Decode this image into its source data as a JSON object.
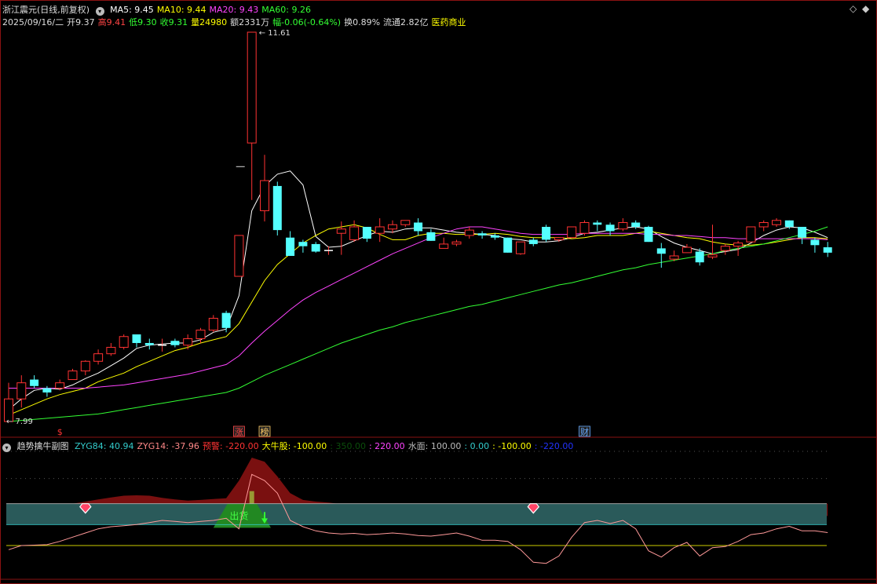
{
  "header": {
    "stock_title": "浙江震元(日线,前复权)",
    "ma_items": [
      {
        "label": "MA5: 9.45",
        "color": "#ffffff"
      },
      {
        "label": "MA10: 9.44",
        "color": "#ffff00"
      },
      {
        "label": "MA20: 9.43",
        "color": "#ff44ff"
      },
      {
        "label": "MA60: 9.26",
        "color": "#33ff33"
      }
    ],
    "quote_items": [
      {
        "label": "2025/09/16/二",
        "color": "#dddddd"
      },
      {
        "label": "开9.37",
        "color": "#dddddd"
      },
      {
        "label": "高9.41",
        "color": "#ff4444"
      },
      {
        "label": "低9.30",
        "color": "#33ff33"
      },
      {
        "label": "收9.31",
        "color": "#33ff33"
      },
      {
        "label": "量24980",
        "color": "#ffff00"
      },
      {
        "label": "额2331万",
        "color": "#dddddd"
      },
      {
        "label": "幅-0.06(-0.64%)",
        "color": "#33ff33"
      },
      {
        "label": "换0.89%",
        "color": "#dddddd"
      },
      {
        "label": "流通2.82亿",
        "color": "#dddddd"
      },
      {
        "label": "医药商业",
        "color": "#ffff00"
      }
    ]
  },
  "sub_header": {
    "title": "趋势擒牛副图",
    "items": [
      {
        "label": "ZYG84: 40.94",
        "color": "#33cccc"
      },
      {
        "label": "ZYG14: -37.96",
        "color": "#ff8888"
      },
      {
        "label": "预警: -220.00",
        "color": "#ff3333"
      },
      {
        "label": "大牛股: -100.00",
        "color": "#ffff00"
      },
      {
        "label": ": 350.00",
        "color": "#0b4d0b"
      },
      {
        "label": ": 220.00",
        "color": "#ff44ff"
      },
      {
        "label": "水面: 100.00",
        "color": "#bbbbbb"
      },
      {
        "label": ": 0.00",
        "color": "#33cccc"
      },
      {
        "label": ": -100.00",
        "color": "#ffff00"
      },
      {
        "label": ": -220.00",
        "color": "#2233ff"
      }
    ]
  },
  "controls": {
    "expand_icon": "◇",
    "collapse_icon": "◆",
    "menu_icon": "▾"
  },
  "chart_data": {
    "type": "candlestick",
    "y_range": [
      7.99,
      11.61
    ],
    "price_high_label": "11.61",
    "price_low_label": "7.99",
    "event_markers": [
      {
        "label": "$",
        "bar": 4,
        "color": "#ff3333"
      },
      {
        "label": "涨",
        "bar": 18,
        "color": "#ff4444"
      },
      {
        "label": "榜",
        "bar": 20,
        "color": "#ffcc66"
      },
      {
        "label": "财",
        "bar": 45,
        "color": "#66aaff"
      }
    ],
    "candles": [
      [
        7.99,
        8.2,
        8.35,
        7.99
      ],
      [
        8.2,
        8.35,
        8.42,
        8.12
      ],
      [
        8.38,
        8.32,
        8.42,
        8.3
      ],
      [
        8.3,
        8.26,
        8.32,
        8.22
      ],
      [
        8.3,
        8.35,
        8.38,
        8.28
      ],
      [
        8.38,
        8.46,
        8.48,
        8.38
      ],
      [
        8.46,
        8.55,
        8.56,
        8.42
      ],
      [
        8.55,
        8.62,
        8.66,
        8.52
      ],
      [
        8.62,
        8.68,
        8.72,
        8.6
      ],
      [
        8.68,
        8.78,
        8.8,
        8.66
      ],
      [
        8.8,
        8.72,
        8.8,
        8.68
      ],
      [
        8.72,
        8.7,
        8.76,
        8.66
      ],
      [
        8.7,
        8.7,
        8.76,
        8.64
      ],
      [
        8.74,
        8.7,
        8.76,
        8.68
      ],
      [
        8.7,
        8.76,
        8.8,
        8.66
      ],
      [
        8.76,
        8.84,
        8.86,
        8.72
      ],
      [
        8.84,
        8.95,
        8.98,
        8.82
      ],
      [
        9.0,
        8.86,
        9.02,
        8.82
      ],
      [
        9.34,
        9.72,
        9.72,
        9.34
      ],
      [
        10.58,
        11.61,
        11.61,
        10.05
      ],
      [
        9.95,
        10.23,
        10.47,
        9.85
      ],
      [
        10.18,
        9.77,
        10.22,
        9.72
      ],
      [
        9.7,
        9.53,
        9.76,
        9.53
      ],
      [
        9.66,
        9.62,
        9.68,
        9.56
      ],
      [
        9.64,
        9.57,
        9.66,
        9.56
      ],
      [
        9.58,
        9.58,
        9.62,
        9.54
      ],
      [
        9.74,
        9.78,
        9.85,
        9.54
      ],
      [
        9.68,
        9.8,
        9.86,
        9.66
      ],
      [
        9.8,
        9.69,
        9.8,
        9.66
      ],
      [
        9.74,
        9.8,
        9.88,
        9.66
      ],
      [
        9.78,
        9.82,
        9.86,
        9.74
      ],
      [
        9.82,
        9.86,
        9.86,
        9.8
      ],
      [
        9.84,
        9.76,
        9.88,
        9.72
      ],
      [
        9.75,
        9.67,
        9.78,
        9.67
      ],
      [
        9.6,
        9.64,
        9.7,
        9.6
      ],
      [
        9.64,
        9.66,
        9.68,
        9.62
      ],
      [
        9.72,
        9.77,
        9.8,
        9.69
      ],
      [
        9.74,
        9.72,
        9.76,
        9.69
      ],
      [
        9.72,
        9.7,
        9.74,
        9.68
      ],
      [
        9.7,
        9.56,
        9.7,
        9.56
      ],
      [
        9.55,
        9.66,
        9.66,
        9.54
      ],
      [
        9.68,
        9.64,
        9.7,
        9.62
      ],
      [
        9.8,
        9.68,
        9.82,
        9.66
      ],
      [
        9.68,
        9.7,
        9.7,
        9.66
      ],
      [
        9.7,
        9.8,
        9.8,
        9.7
      ],
      [
        9.74,
        9.84,
        9.86,
        9.72
      ],
      [
        9.84,
        9.82,
        9.86,
        9.76
      ],
      [
        9.82,
        9.76,
        9.84,
        9.72
      ],
      [
        9.78,
        9.84,
        9.88,
        9.76
      ],
      [
        9.84,
        9.8,
        9.86,
        9.78
      ],
      [
        9.8,
        9.66,
        9.81,
        9.66
      ],
      [
        9.6,
        9.55,
        9.65,
        9.42
      ],
      [
        9.5,
        9.53,
        9.58,
        9.48
      ],
      [
        9.56,
        9.61,
        9.64,
        9.56
      ],
      [
        9.57,
        9.47,
        9.6,
        9.44
      ],
      [
        9.52,
        9.54,
        9.82,
        9.5
      ],
      [
        9.58,
        9.62,
        9.64,
        9.54
      ],
      [
        9.62,
        9.65,
        9.67,
        9.53
      ],
      [
        9.66,
        9.8,
        9.8,
        9.66
      ],
      [
        9.8,
        9.84,
        9.86,
        9.76
      ],
      [
        9.82,
        9.86,
        9.88,
        9.8
      ],
      [
        9.86,
        9.8,
        9.86,
        9.78
      ],
      [
        9.8,
        9.7,
        9.8,
        9.64
      ],
      [
        9.68,
        9.63,
        9.7,
        9.56
      ],
      [
        9.61,
        9.56,
        9.66,
        9.52
      ]
    ],
    "ma_series": [
      {
        "name": "MA5",
        "color": "#ffffff",
        "values": [
          8.1,
          8.2,
          8.28,
          8.3,
          8.29,
          8.33,
          8.39,
          8.44,
          8.51,
          8.58,
          8.67,
          8.7,
          8.71,
          8.72,
          8.72,
          8.75,
          8.82,
          8.85,
          9.16,
          9.95,
          10.18,
          10.29,
          10.32,
          10.19,
          9.71,
          9.61,
          9.62,
          9.67,
          9.72,
          9.76,
          9.75,
          9.78,
          9.79,
          9.79,
          9.77,
          9.75,
          9.74,
          9.73,
          9.72,
          9.69,
          9.68,
          9.66,
          9.66,
          9.67,
          9.7,
          9.74,
          9.75,
          9.77,
          9.79,
          9.8,
          9.78,
          9.71,
          9.65,
          9.61,
          9.58,
          9.55,
          9.57,
          9.59,
          9.65,
          9.72,
          9.77,
          9.8,
          9.79,
          9.75,
          9.7
        ]
      },
      {
        "name": "MA10",
        "color": "#ffff00",
        "values": [
          8.05,
          8.1,
          8.15,
          8.2,
          8.24,
          8.27,
          8.3,
          8.36,
          8.4,
          8.44,
          8.5,
          8.55,
          8.6,
          8.65,
          8.68,
          8.72,
          8.75,
          8.78,
          8.9,
          9.1,
          9.3,
          9.45,
          9.55,
          9.65,
          9.72,
          9.78,
          9.8,
          9.82,
          9.79,
          9.73,
          9.68,
          9.68,
          9.72,
          9.74,
          9.74,
          9.73,
          9.73,
          9.73,
          9.74,
          9.73,
          9.71,
          9.7,
          9.7,
          9.7,
          9.69,
          9.7,
          9.72,
          9.72,
          9.72,
          9.74,
          9.76,
          9.74,
          9.72,
          9.7,
          9.69,
          9.66,
          9.64,
          9.63,
          9.63,
          9.64,
          9.66,
          9.68,
          9.7,
          9.7,
          9.69
        ]
      },
      {
        "name": "MA20",
        "color": "#ff44ff",
        "values": [
          8.3,
          8.3,
          8.3,
          8.3,
          8.3,
          8.3,
          8.3,
          8.31,
          8.32,
          8.33,
          8.35,
          8.37,
          8.39,
          8.41,
          8.43,
          8.46,
          8.49,
          8.52,
          8.6,
          8.72,
          8.83,
          8.93,
          9.03,
          9.12,
          9.19,
          9.25,
          9.31,
          9.37,
          9.43,
          9.49,
          9.55,
          9.6,
          9.65,
          9.7,
          9.74,
          9.78,
          9.8,
          9.8,
          9.78,
          9.76,
          9.74,
          9.73,
          9.73,
          9.73,
          9.73,
          9.74,
          9.74,
          9.74,
          9.74,
          9.74,
          9.73,
          9.73,
          9.72,
          9.72,
          9.71,
          9.7,
          9.7,
          9.69,
          9.69,
          9.69,
          9.69,
          9.69,
          9.69,
          9.69,
          9.68
        ]
      },
      {
        "name": "MA60",
        "color": "#33ff33",
        "values": [
          7.99,
          8.0,
          8.01,
          8.02,
          8.03,
          8.04,
          8.05,
          8.06,
          8.08,
          8.1,
          8.12,
          8.14,
          8.16,
          8.18,
          8.2,
          8.22,
          8.24,
          8.26,
          8.3,
          8.36,
          8.42,
          8.47,
          8.52,
          8.57,
          8.62,
          8.67,
          8.72,
          8.76,
          8.8,
          8.84,
          8.87,
          8.91,
          8.94,
          8.97,
          9.0,
          9.03,
          9.06,
          9.08,
          9.11,
          9.14,
          9.17,
          9.2,
          9.23,
          9.26,
          9.28,
          9.31,
          9.34,
          9.37,
          9.4,
          9.42,
          9.45,
          9.47,
          9.49,
          9.51,
          9.53,
          9.55,
          9.58,
          9.6,
          9.62,
          9.64,
          9.67,
          9.7,
          9.73,
          9.76,
          9.8
        ]
      }
    ],
    "indicator": {
      "y_range": [
        -220,
        350
      ],
      "levels": [
        {
          "value": 100,
          "color": "#bbbbbb"
        },
        {
          "value": 0,
          "color": "#33cccc"
        },
        {
          "value": -100,
          "color": "#ffff00"
        },
        {
          "value": -220,
          "color": "#2233ff"
        }
      ],
      "zyg84_area_color": "#7a1010",
      "zyg84_values": [
        55,
        70,
        85,
        90,
        95,
        100,
        110,
        120,
        130,
        138,
        140,
        138,
        128,
        120,
        115,
        118,
        122,
        126,
        210,
        320,
        300,
        230,
        150,
        118,
        110,
        105,
        98,
        95,
        94,
        93,
        93,
        94,
        94,
        90,
        90,
        88,
        86,
        85,
        84,
        82,
        80,
        80,
        80,
        80,
        78,
        75,
        72,
        70,
        68,
        66,
        64,
        60,
        58,
        56,
        55,
        54,
        54,
        52,
        50,
        48,
        47,
        46,
        46,
        45,
        41
      ],
      "water_band_color": "#2a5a5a",
      "water_band": [
        0,
        100
      ],
      "zyg14_color": "#ff9999",
      "zyg14_values": [
        -120,
        -100,
        -98,
        -96,
        -80,
        -60,
        -40,
        -20,
        -10,
        -5,
        0,
        10,
        20,
        15,
        10,
        15,
        20,
        30,
        -20,
        240,
        210,
        150,
        20,
        -10,
        -30,
        -40,
        -45,
        -42,
        -48,
        -45,
        -40,
        -45,
        -52,
        -55,
        -48,
        -40,
        -55,
        -75,
        -75,
        -80,
        -120,
        -180,
        -185,
        -150,
        -60,
        10,
        20,
        5,
        20,
        -20,
        -125,
        -155,
        -110,
        -85,
        -150,
        -110,
        -105,
        -80,
        -48,
        -40,
        -20,
        -8,
        -30,
        -30,
        -38
      ],
      "exit_label": "出货",
      "exit_area_color": "#228822",
      "exit_range": [
        16,
        20
      ],
      "bull_bar": {
        "bar": 19,
        "value": 100,
        "color": "#999933"
      },
      "warn_markers": [
        6,
        41
      ],
      "down_arrow_bar": 20
    }
  }
}
